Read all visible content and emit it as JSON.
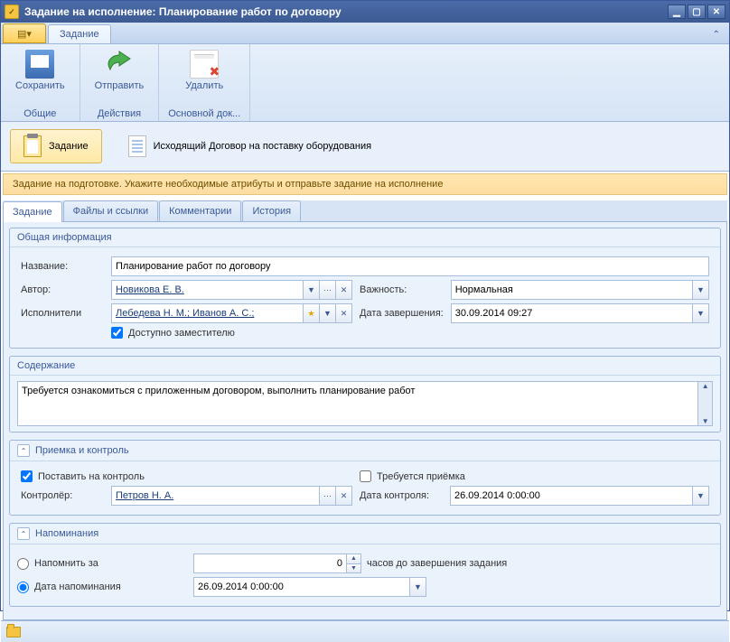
{
  "window": {
    "title": "Задание на исполнение: Планирование работ по договору"
  },
  "ribbon": {
    "tab": "Задание",
    "save": "Сохранить",
    "send": "Отправить",
    "delete": "Удалить",
    "group_common": "Общие",
    "group_actions": "Действия",
    "group_maindoc": "Основной док..."
  },
  "context": {
    "task": "Задание",
    "doc": "Исходящий Договор на поставку оборудования"
  },
  "status_strip": "Задание на подготовке. Укажите необходимые атрибуты и отправьте задание на исполнение",
  "tabs": {
    "task": "Задание",
    "files": "Файлы и ссылки",
    "comments": "Комментарии",
    "history": "История"
  },
  "general": {
    "header": "Общая информация",
    "name_lbl": "Название:",
    "name": "Планирование работ по договору",
    "author_lbl": "Автор:",
    "author": "Новикова Е. В.",
    "importance_lbl": "Важность:",
    "importance": "Нормальная",
    "performers_lbl": "Исполнители",
    "performers": "Лебедева Н. М.; Иванов А. С.;",
    "due_lbl": "Дата завершения:",
    "due": "30.09.2014 09:27",
    "deputy": "Доступно заместителю"
  },
  "content": {
    "header": "Содержание",
    "text": "Требуется ознакомиться с приложенным договором, выполнить планирование работ"
  },
  "accept": {
    "header": "Приемка и контроль",
    "put_on_control": "Поставить на контроль",
    "need_accept": "Требуется приёмка",
    "controller_lbl": "Контролёр:",
    "controller": "Петров Н. А.",
    "control_date_lbl": "Дата контроля:",
    "control_date": "26.09.2014 0:00:00"
  },
  "reminders": {
    "header": "Напоминания",
    "remind_in": "Напомнить за",
    "hours_tail": "часов до завершения задания",
    "value": "0",
    "remind_date_lbl": "Дата напоминания",
    "remind_date": "26.09.2014 0:00:00"
  }
}
